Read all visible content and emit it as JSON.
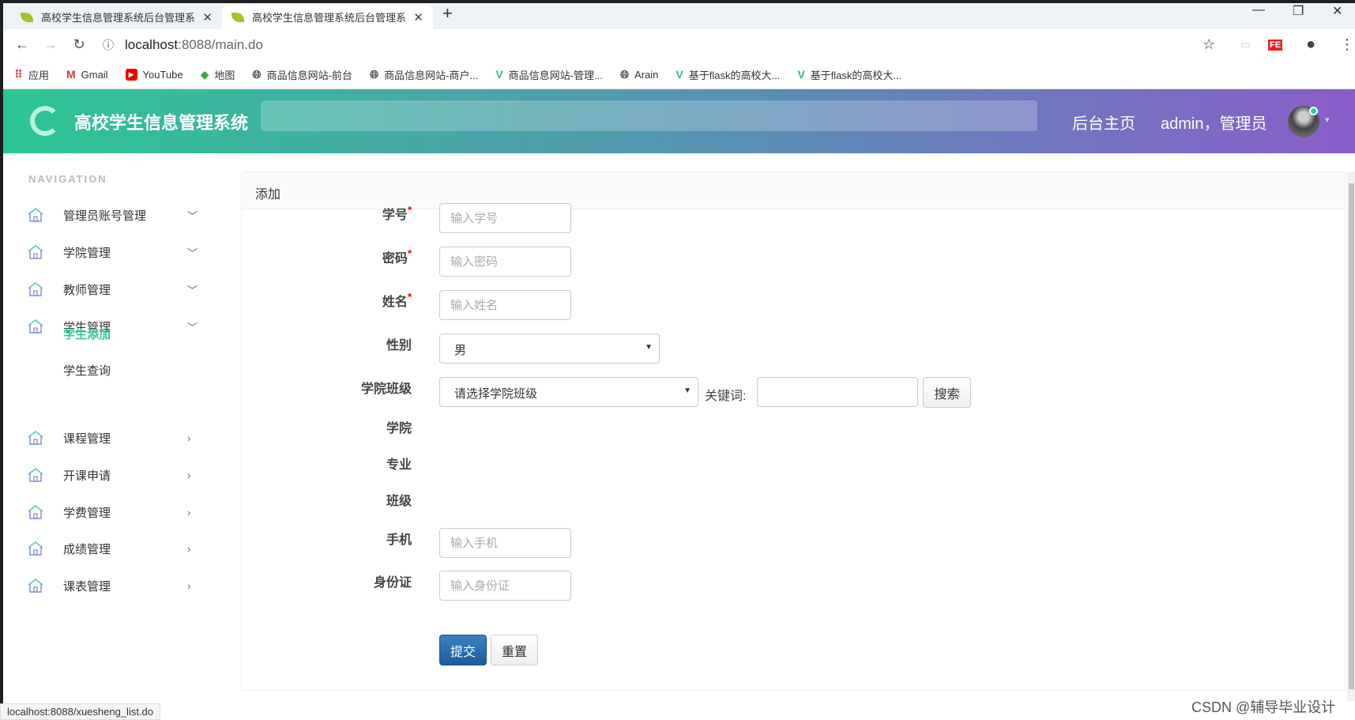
{
  "browser": {
    "tabs": [
      {
        "title": "高校学生信息管理系统后台管理系"
      },
      {
        "title": "高校学生信息管理系统后台管理系"
      }
    ],
    "url_host": "localhost",
    "url_rest": ":8088/main.do",
    "bookmarks": [
      {
        "label": "应用",
        "icon": "apps-grid-icon"
      },
      {
        "label": "Gmail",
        "icon": "gmail-icon"
      },
      {
        "label": "YouTube",
        "icon": "youtube-icon"
      },
      {
        "label": "地图",
        "icon": "maps-icon"
      },
      {
        "label": "商品信息网站-前台",
        "icon": "globe-icon"
      },
      {
        "label": "商品信息网站-商户...",
        "icon": "globe-icon"
      },
      {
        "label": "商品信息网站-管理...",
        "icon": "vue-icon"
      },
      {
        "label": "Arain",
        "icon": "globe-icon"
      },
      {
        "label": "基于flask的高校大...",
        "icon": "vue-icon"
      },
      {
        "label": "基于flask的高校大...",
        "icon": "vue-icon"
      }
    ],
    "status_url": "localhost:8088/xuesheng_list.do"
  },
  "header": {
    "brand": "高校学生信息管理系统",
    "home_link": "后台主页",
    "user": "admin，管理员",
    "accent_from": "#2cc695",
    "accent_to": "#8a5dca"
  },
  "sidebar": {
    "title": "NAVIGATION",
    "items": [
      {
        "label": "管理员账号管理",
        "chevron": "down"
      },
      {
        "label": "学院管理",
        "chevron": "down"
      },
      {
        "label": "教师管理",
        "chevron": "down"
      },
      {
        "label": "学生管理",
        "chevron": "down"
      },
      {
        "label": "课程管理",
        "chevron": "right"
      },
      {
        "label": "开课申请",
        "chevron": "right"
      },
      {
        "label": "学费管理",
        "chevron": "right"
      },
      {
        "label": "成绩管理",
        "chevron": "right"
      },
      {
        "label": "课表管理",
        "chevron": "right"
      }
    ],
    "subitems": [
      {
        "label": "学生添加",
        "active": true
      },
      {
        "label": "学生查询",
        "active": false
      }
    ],
    "active_color": "#2ecb8d"
  },
  "form": {
    "title": "添加",
    "required_mark": "*",
    "xuehao": {
      "label": "学号",
      "placeholder": "输入学号",
      "value": ""
    },
    "mima": {
      "label": "密码",
      "placeholder": "输入密码",
      "value": ""
    },
    "xingming": {
      "label": "姓名",
      "placeholder": "输入姓名",
      "value": ""
    },
    "xingbie": {
      "label": "性别",
      "value": "男"
    },
    "banji_select": {
      "label": "学院班级",
      "value": "请选择学院班级"
    },
    "keyword": {
      "label": "关键词:",
      "value": ""
    },
    "search_label": "搜索",
    "xueyuan": {
      "label": "学院"
    },
    "zhuanye": {
      "label": "专业"
    },
    "banji": {
      "label": "班级"
    },
    "shouji": {
      "label": "手机",
      "placeholder": "输入手机",
      "value": ""
    },
    "shenfenzheng": {
      "label": "身份证",
      "placeholder": "输入身份证",
      "value": ""
    },
    "submit_label": "提交",
    "reset_label": "重置"
  },
  "watermark": "CSDN @辅导毕业设计"
}
